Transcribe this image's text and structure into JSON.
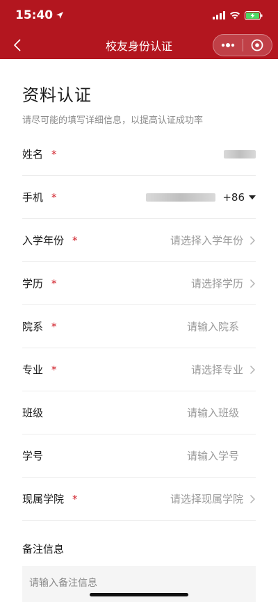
{
  "status": {
    "time": "15:40"
  },
  "nav": {
    "title": "校友身份认证"
  },
  "header": {
    "title": "资料认证",
    "subtitle": "请尽可能的填写详细信息，以提高认证成功率"
  },
  "fields": [
    {
      "label": "姓名",
      "required": "*",
      "value": ""
    },
    {
      "label": "手机",
      "required": "*",
      "value": "",
      "country_code": "+86"
    },
    {
      "label": "入学年份",
      "required": "*",
      "placeholder": "请选择入学年份"
    },
    {
      "label": "学历",
      "required": "*",
      "placeholder": "请选择学历"
    },
    {
      "label": "院系",
      "required": "*",
      "placeholder": "请输入院系"
    },
    {
      "label": "专业",
      "required": "*",
      "placeholder": "请选择专业"
    },
    {
      "label": "班级",
      "placeholder": "请输入班级"
    },
    {
      "label": "学号",
      "placeholder": "请输入学号"
    },
    {
      "label": "现属学院",
      "required": "*",
      "placeholder": "请选择现属学院"
    }
  ],
  "remark": {
    "label": "备注信息",
    "placeholder": "请输入备注信息"
  },
  "colors": {
    "brand": "#b3161f",
    "required": "#d0202a"
  }
}
